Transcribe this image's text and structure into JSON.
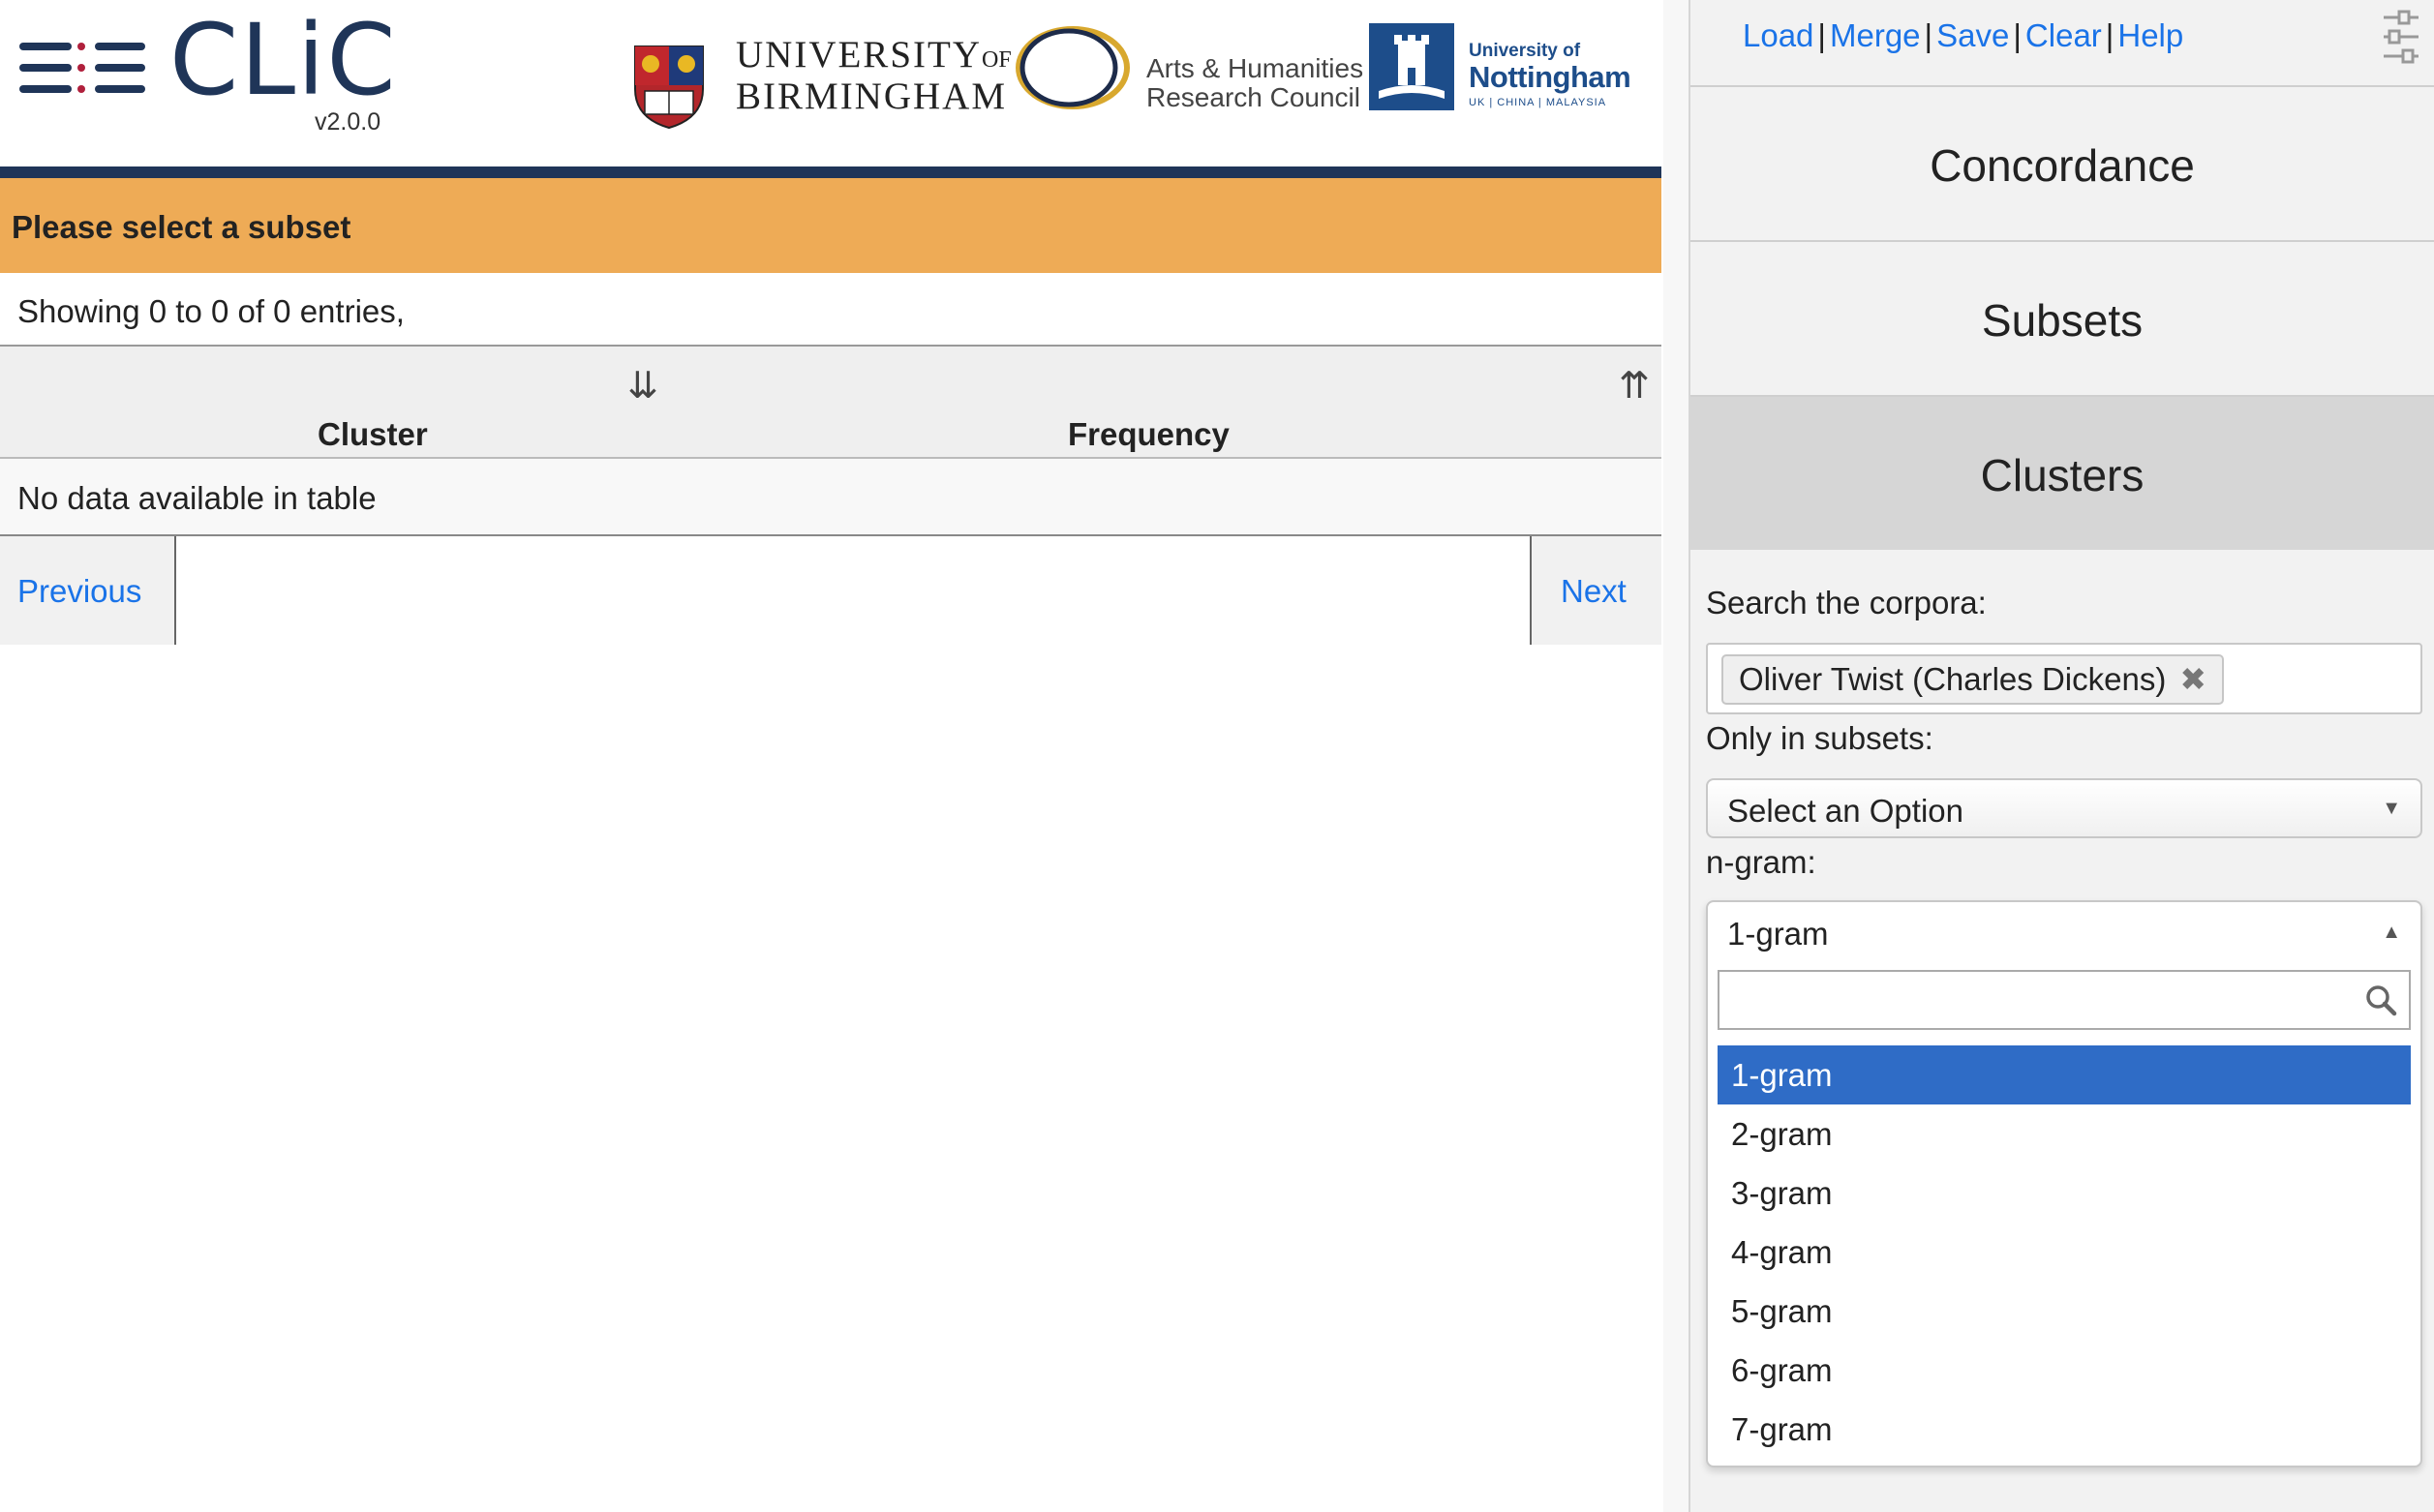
{
  "brand": {
    "name": "CLiC",
    "version": "v2.0.0",
    "partners": {
      "birmingham_line1": "UNIVERSITY",
      "birmingham_of": "OF",
      "birmingham_line2": "BIRMINGHAM",
      "ahrc_line1": "Arts & Humanities",
      "ahrc_line2": "Research Council",
      "nottingham_line1": "University of",
      "nottingham_line2": "Nottingham",
      "nottingham_line3": "UK | CHINA | MALAYSIA"
    }
  },
  "alert": {
    "message": "Please select a subset"
  },
  "table": {
    "info": "Showing 0 to 0 of 0 entries,",
    "columns": [
      "Cluster",
      "Frequency"
    ],
    "empty_message": "No data available in table"
  },
  "pager": {
    "previous": "Previous",
    "next": "Next"
  },
  "panel": {
    "menu": [
      "Load",
      "Merge",
      "Save",
      "Clear",
      "Help"
    ],
    "accordion": [
      "Concordance",
      "Subsets",
      "Clusters"
    ],
    "active_section": "Clusters",
    "search_label": "Search the corpora:",
    "corpora_chip": "Oliver Twist (Charles Dickens)",
    "subsets_label": "Only in subsets:",
    "subsets_placeholder": "Select an Option",
    "ngram_label": "n-gram:",
    "ngram_selected": "1-gram",
    "ngram_search_value": "",
    "ngram_options": [
      "1-gram",
      "2-gram",
      "3-gram",
      "4-gram",
      "5-gram",
      "6-gram",
      "7-gram"
    ]
  },
  "colors": {
    "navy": "#1f3558",
    "alert": "#eeab56",
    "link": "#1a73e8",
    "option_highlight": "#2f6cc6",
    "active_tab": "#d6d6d6"
  },
  "icons": [
    "sort-desc-icon",
    "sort-asc-icon",
    "settings-sliders-icon",
    "remove-icon",
    "caret-down-icon",
    "caret-up-icon",
    "search-icon"
  ]
}
